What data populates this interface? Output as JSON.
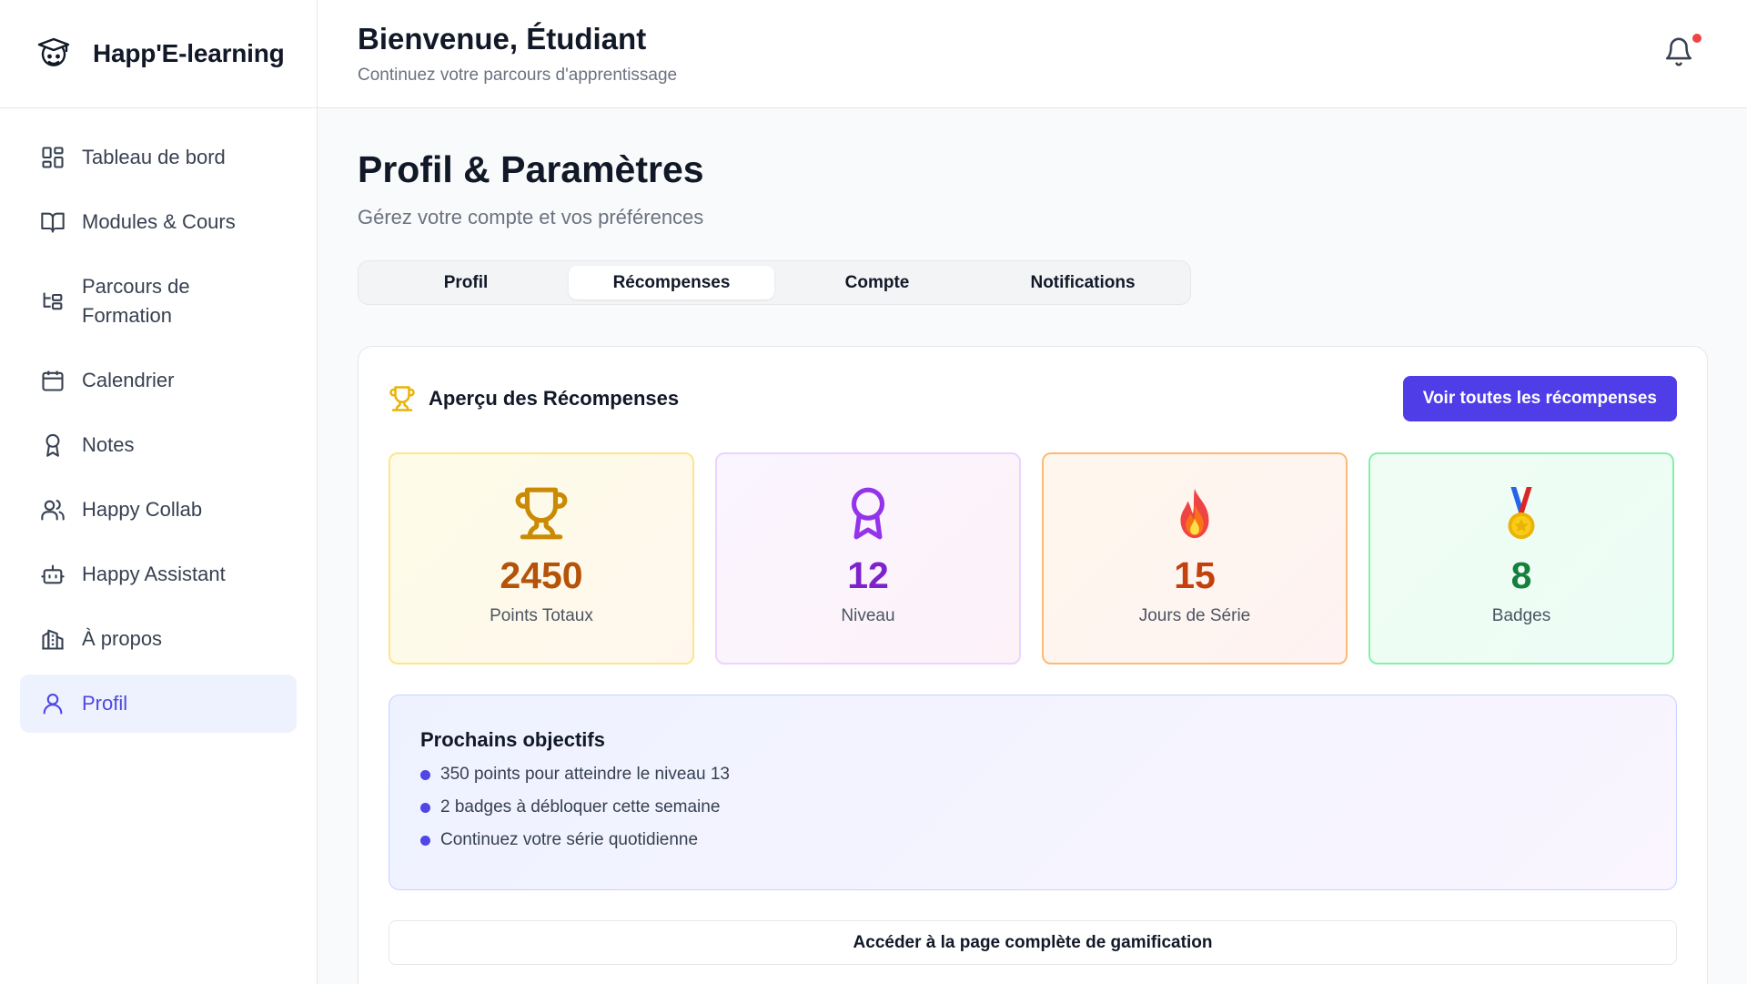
{
  "app": {
    "brand": "Happ'E-learning"
  },
  "header": {
    "title": "Bienvenue, Étudiant",
    "subtitle": "Continuez votre parcours d'apprentissage"
  },
  "sidebar": {
    "items": [
      {
        "label": "Tableau de bord",
        "icon": "dashboard-icon"
      },
      {
        "label": "Modules & Cours",
        "icon": "book-icon"
      },
      {
        "label": "Parcours de Formation",
        "icon": "path-tree-icon"
      },
      {
        "label": "Calendrier",
        "icon": "calendar-icon"
      },
      {
        "label": "Notes",
        "icon": "award-icon"
      },
      {
        "label": "Happy Collab",
        "icon": "users-icon"
      },
      {
        "label": "Happy Assistant",
        "icon": "bot-icon"
      },
      {
        "label": "À propos",
        "icon": "building-icon"
      },
      {
        "label": "Profil",
        "icon": "user-icon",
        "active": true
      }
    ]
  },
  "page": {
    "title": "Profil & Paramètres",
    "subtitle": "Gérez votre compte et vos préférences"
  },
  "tabs": [
    {
      "label": "Profil"
    },
    {
      "label": "Récompenses",
      "active": true
    },
    {
      "label": "Compte"
    },
    {
      "label": "Notifications"
    }
  ],
  "rewards": {
    "title": "Aperçu des Récompenses",
    "view_all_label": "Voir toutes les récompenses",
    "stats": [
      {
        "value": "2450",
        "label": "Points Totaux",
        "icon": "trophy-icon"
      },
      {
        "value": "12",
        "label": "Niveau",
        "icon": "award-ribbon-icon"
      },
      {
        "value": "15",
        "label": "Jours de Série",
        "icon": "fire-icon"
      },
      {
        "value": "8",
        "label": "Badges",
        "icon": "medal-icon"
      }
    ],
    "goals": {
      "title": "Prochains objectifs",
      "items": [
        "350 points pour atteindre le niveau 13",
        "2 badges à débloquer cette semaine",
        "Continuez votre série quotidienne"
      ]
    },
    "gamification_label": "Accéder à la page complète de gamification"
  },
  "colors": {
    "accent": "#4f3de8",
    "active_nav_bg": "#eef2ff",
    "notification_dot": "#ef4444"
  }
}
